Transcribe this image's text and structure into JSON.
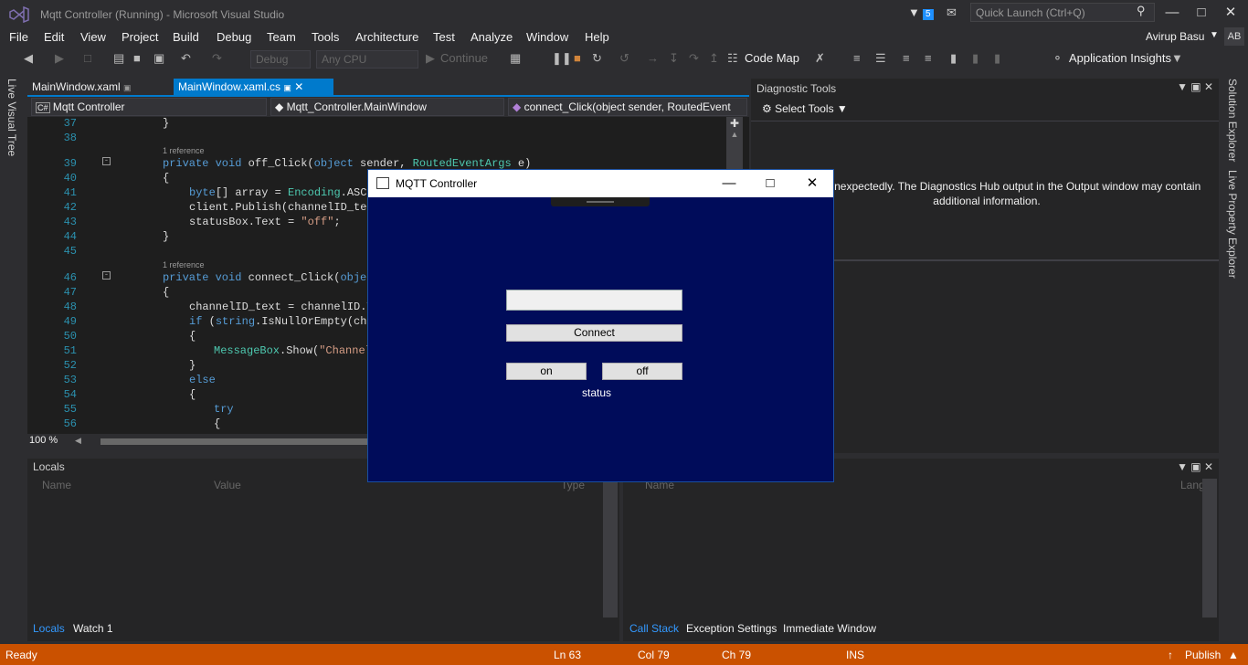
{
  "window": {
    "title": "Mqtt Controller (Running) - Microsoft Visual Studio",
    "notifications": "5",
    "quick_launch": "Quick Launch (Ctrl+Q)",
    "user": "Avirup Basu",
    "avatar": "AB"
  },
  "menu": [
    "File",
    "Edit",
    "View",
    "Project",
    "Build",
    "Debug",
    "Team",
    "Tools",
    "Architecture",
    "Test",
    "Analyze",
    "Window",
    "Help"
  ],
  "toolbar": {
    "config": "Debug",
    "platform": "Any CPU",
    "continue": "Continue",
    "code_map": "Code Map",
    "app_insights": "Application Insights"
  },
  "tabs": {
    "tab1": "MainWindow.xaml",
    "tab2": "MainWindow.xaml.cs"
  },
  "nav": {
    "project": "Mqtt Controller",
    "class": "Mqtt_Controller.MainWindow",
    "member": "connect_Click(object sender, RoutedEvent"
  },
  "side_left": "Live Visual Tree",
  "side_right": [
    "Solution Explorer",
    "Live Property Explorer"
  ],
  "code": {
    "l37": "}",
    "l39a": "private void ",
    "l39b": "off_Click(",
    "l39c": "object",
    "l39d": " sender, ",
    "l39e": "RoutedEventArgs",
    "l39f": " e)",
    "l40": "{",
    "l41a": "byte",
    "l41b": "[] array = ",
    "l41c": "Encoding",
    "l41d": ".ASCII",
    "l42": "client.Publish(channelID_tex",
    "l43a": "statusBox.Text = ",
    "l43b": "\"off\"",
    "l43c": ";",
    "l44": "}",
    "ref": "1 reference",
    "l46a": "private void ",
    "l46b": "connect_Click(",
    "l46c": "object",
    "l47": "{",
    "l48": "channelID_text = channelID.T",
    "l49a": "if",
    "l49b": " (",
    "l49c": "string",
    "l49d": ".IsNullOrEmpty(cha",
    "l50": "{",
    "l51a": "MessageBox",
    "l51b": ".Show(",
    "l51c": "\"Channel",
    "l52": "}",
    "l53": "else",
    "l54": "{",
    "l55": "try",
    "l56": "{"
  },
  "lines": [
    "37",
    "38",
    "39",
    "40",
    "41",
    "42",
    "43",
    "44",
    "45",
    "46",
    "47",
    "48",
    "49",
    "50",
    "51",
    "52",
    "53",
    "54",
    "55",
    "56"
  ],
  "zoom": "100 %",
  "diagnostics": {
    "title": "Diagnostic Tools",
    "select_tools": "Select Tools",
    "message": "tools failed unexpectedly. The Diagnostics Hub output in the Output window may contain additional information."
  },
  "locals": {
    "title": "Locals",
    "cols": [
      "Name",
      "Value",
      "Type"
    ]
  },
  "callstack": {
    "cols": [
      "Name",
      "Lang"
    ]
  },
  "bottom_tabs": [
    "Locals",
    "Watch 1",
    "Call Stack",
    "Exception Settings",
    "Immediate Window"
  ],
  "status": {
    "ready": "Ready",
    "ln": "Ln 63",
    "col": "Col 79",
    "ch": "Ch 79",
    "ins": "INS",
    "publish": "Publish"
  },
  "app": {
    "title": "MQTT Controller",
    "connect": "Connect",
    "on": "on",
    "off": "off",
    "status": "status"
  }
}
